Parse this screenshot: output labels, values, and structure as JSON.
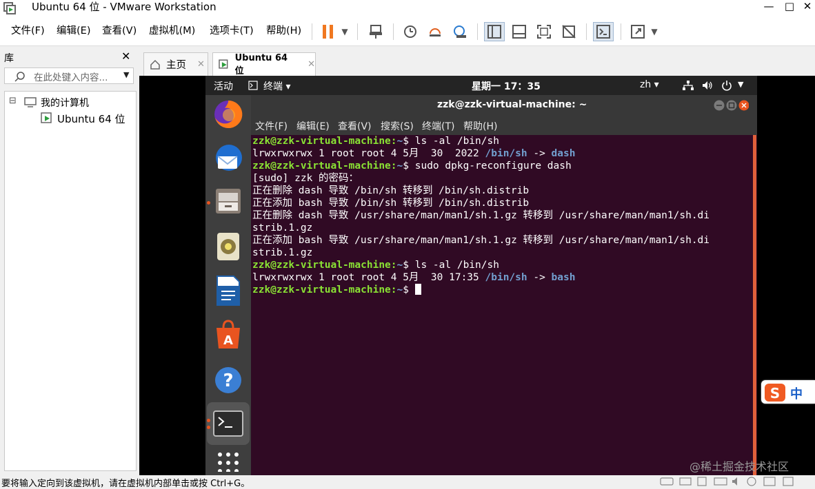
{
  "window": {
    "title": "Ubuntu 64 位 - VMware Workstation",
    "controls": {
      "minimize": "—",
      "maximize": "□",
      "close": "✕"
    }
  },
  "menu": [
    "文件(F)",
    "编辑(E)",
    "查看(V)",
    "虚拟机(M)",
    "选项卡(T)",
    "帮助(H)"
  ],
  "library": {
    "title": "库",
    "close": "✕",
    "search_placeholder": "在此处键入内容...",
    "tree": {
      "root": "我的计算机",
      "child": "Ubuntu 64 位",
      "expander": "⊟"
    }
  },
  "tabs": [
    {
      "label": "主页",
      "close": "✕"
    },
    {
      "label": "Ubuntu 64 位",
      "close": "✕"
    }
  ],
  "ubuntu": {
    "activities": "活动",
    "app_menu": "终端 ▾",
    "clock": "星期一 17：35",
    "lang": "zh ▾",
    "terminal": {
      "title": "zzk@zzk-virtual-machine: ~",
      "menu": [
        "文件(F)",
        "编辑(E)",
        "查看(V)",
        "搜索(S)",
        "终端(T)",
        "帮助(H)"
      ],
      "lines": [
        {
          "prompt": "zzk@zzk-virtual-machine",
          "path": "~",
          "cmd": " ls -al /bin/sh"
        },
        {
          "text": "lrwxrwxrwx 1 root root 4 5月  30  2022 ",
          "link": "/bin/sh",
          "rest": " -> ",
          "target": "dash"
        },
        {
          "prompt": "zzk@zzk-virtual-machine",
          "path": "~",
          "cmd": " sudo dpkg-reconfigure dash"
        },
        {
          "plain": "[sudo] zzk 的密码："
        },
        {
          "plain": "正在删除 dash 导致 /bin/sh 转移到 /bin/sh.distrib"
        },
        {
          "plain": "正在添加 bash 导致 /bin/sh 转移到 /bin/sh.distrib"
        },
        {
          "plain": "正在删除 dash 导致 /usr/share/man/man1/sh.1.gz 转移到 /usr/share/man/man1/sh.di"
        },
        {
          "plain": "strib.1.gz"
        },
        {
          "plain": "正在添加 bash 导致 /usr/share/man/man1/sh.1.gz 转移到 /usr/share/man/man1/sh.di"
        },
        {
          "plain": "strib.1.gz"
        },
        {
          "prompt": "zzk@zzk-virtual-machine",
          "path": "~",
          "cmd": " ls -al /bin/sh"
        },
        {
          "text": "lrwxrwxrwx 1 root root 4 5月  30 17:35 ",
          "link": "/bin/sh",
          "rest": " -> ",
          "target": "bash"
        },
        {
          "prompt": "zzk@zzk-virtual-machine",
          "path": "~",
          "cmd": " ",
          "cursor": true
        }
      ]
    }
  },
  "status": {
    "message": "要将输入定向到该虚拟机，请在虚拟机内部单击或按 Ctrl+G。",
    "watermark": "@稀土掘金技术社区"
  },
  "ime": {
    "label": "中"
  },
  "colors": {
    "accent": "#e95420",
    "terminal_bg": "#300a24",
    "prompt_green": "#8ae234",
    "path_blue": "#729fcf"
  }
}
